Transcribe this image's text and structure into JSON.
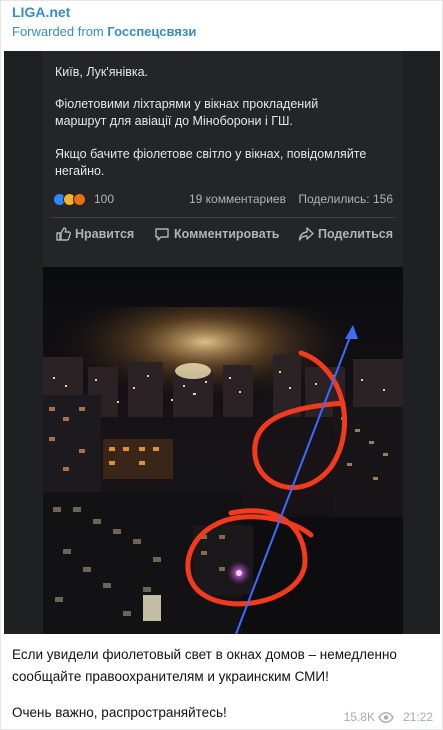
{
  "header": {
    "channel": "LIGA.net",
    "forwarded_prefix": "Forwarded from ",
    "forwarded_source": "Госспецсвязи"
  },
  "fb_post": {
    "line1": "Київ, Лук'янівка.",
    "line2": "Фіолетовими ліхтарями у вікнах прокладений",
    "line3": "маршрут для авіації до Міноборони і ГШ.",
    "line4": "Якщо бачите фіолетове світло у вікнах, повідомляйте",
    "line5": "негайно.",
    "reaction_count": "100",
    "comments": "19 комментариев",
    "shares": "Поделились: 156",
    "like_label": "Нравится",
    "comment_label": "Комментировать",
    "share_label": "Поделиться"
  },
  "message": {
    "caption_1": "Если увидели фиолетовый свет в окнах домов – немедленно сообщайте правоохранителям и украинским СМИ!",
    "caption_2": "Очень важно, распространяйтесь!",
    "views": "15.8K",
    "time": "21:22"
  },
  "colors": {
    "link": "#3a8cc5",
    "fb_bg": "#242526",
    "fb_text": "#e4e6eb",
    "annotation_red": "#f23a1c",
    "annotation_blue": "#3c6cff"
  },
  "icons": [
    "like-icon",
    "comment-icon",
    "share-icon",
    "eye-icon"
  ]
}
